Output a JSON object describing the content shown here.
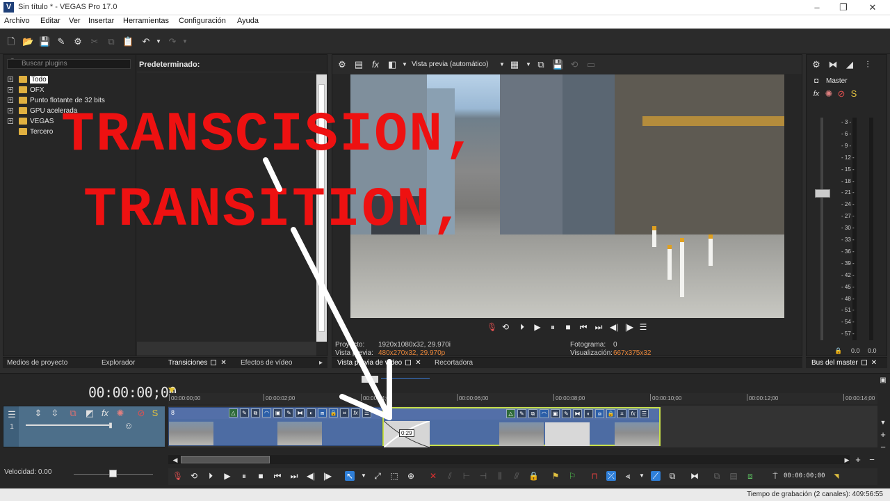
{
  "window": {
    "title": "Sin título * - VEGAS Pro 17.0",
    "logo": "V"
  },
  "menu": [
    "Archivo",
    "Editar",
    "Ver",
    "Insertar",
    "Herramientas",
    "Configuración",
    "Ayuda"
  ],
  "plugin_panel": {
    "search_placeholder": "Buscar plugins",
    "preset_header": "Predeterminado:",
    "tree": [
      "Todo",
      "OFX",
      "Punto flotante de 32 bits",
      "GPU acelerada",
      "VEGAS",
      "Tercero"
    ]
  },
  "tabs_left": [
    "Medios de proyecto",
    "Explorador",
    "Transiciones",
    "Efectos de vídeo"
  ],
  "preview": {
    "mode": "Vista previa (automático)",
    "proyecto_label": "Proyecto:",
    "proyecto_value": "1920x1080x32, 29.970i",
    "vista_label": "Vista previa:",
    "vista_value": "480x270x32, 29.970p",
    "fotograma_label": "Fotograma:",
    "fotograma_value": "0",
    "visual_label": "Visualización:",
    "visual_value": "667x375x32"
  },
  "tabs_mid": [
    "Vista previa de vídeo",
    "Recortadora"
  ],
  "master": {
    "label": "Master",
    "db_marks": [
      "3",
      "6",
      "9",
      "12",
      "15",
      "18",
      "21",
      "24",
      "27",
      "30",
      "33",
      "36",
      "39",
      "42",
      "45",
      "48",
      "51",
      "54",
      "57"
    ],
    "meter_l": "0.0",
    "meter_r": "0.0",
    "tab": "Bus del master"
  },
  "timeline": {
    "time": "00:00:00;00",
    "ruler": [
      "00:00:00;00",
      "00:00:02;00",
      "00:00:04;00",
      "00:00:06;00",
      "00:00:08;00",
      "00:00:10;00",
      "00:00:12;00",
      "00:00:14;00"
    ],
    "clip1_num": "8",
    "transition_time": "0:29",
    "speed_label": "Velocidad: 0.00",
    "small_time": "00:00:00;00"
  },
  "status": {
    "text": "Tiempo de grabación (2 canales): 409:56:55"
  },
  "overlay": {
    "line1": "TRANSCISION,",
    "line2": "TRANSITION,"
  },
  "colors": {
    "overlay_red": "#ee1111",
    "accent_blue": "#2f7fd8",
    "selection_yellow": "#c8e04a"
  }
}
